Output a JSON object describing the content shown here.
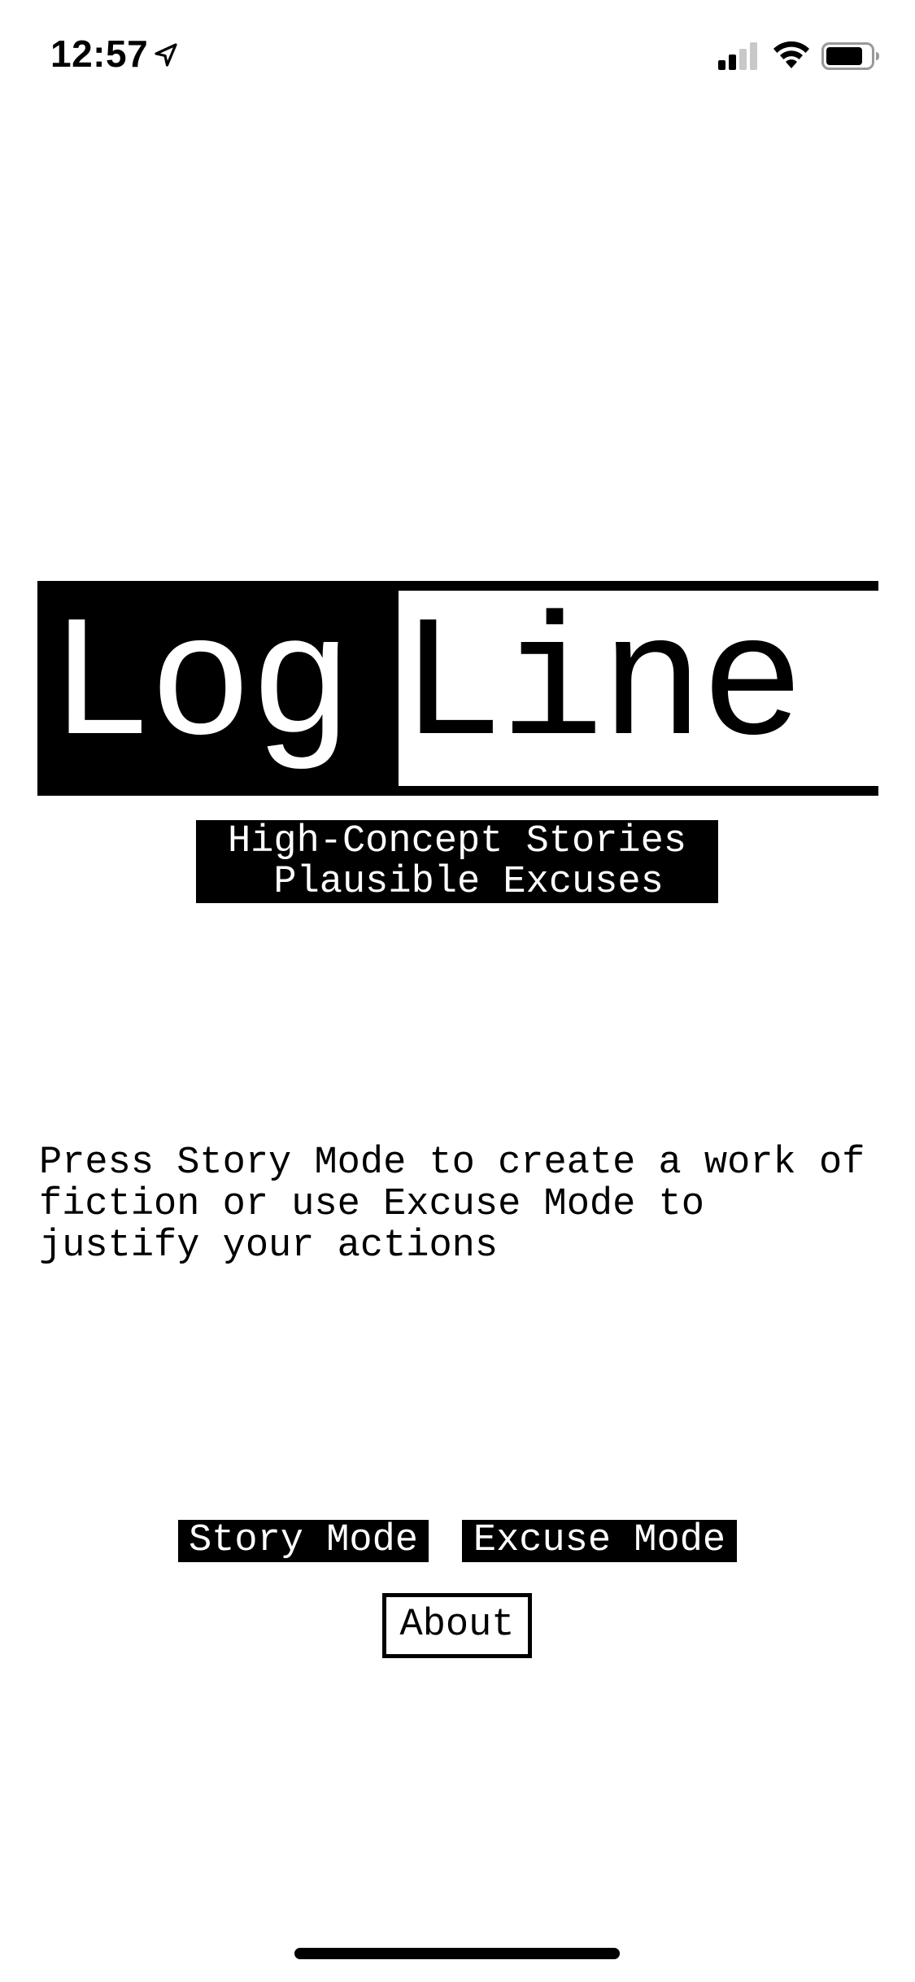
{
  "status_bar": {
    "time": "12:57",
    "icons": [
      "location-arrow-icon",
      "cellular-signal-icon",
      "wifi-icon",
      "battery-icon"
    ]
  },
  "logo": {
    "part1": "Log",
    "part2": "Line"
  },
  "tagline": {
    "line1": "High-Concept Stories",
    "line2": " Plausible Excuses"
  },
  "instructions": "Press Story Mode to create a work of fiction or use Excuse Mode to justify your actions",
  "buttons": {
    "story_mode": "Story Mode",
    "excuse_mode": "Excuse Mode",
    "about": "About"
  },
  "colors": {
    "background": "#ffffff",
    "foreground": "#000000"
  }
}
